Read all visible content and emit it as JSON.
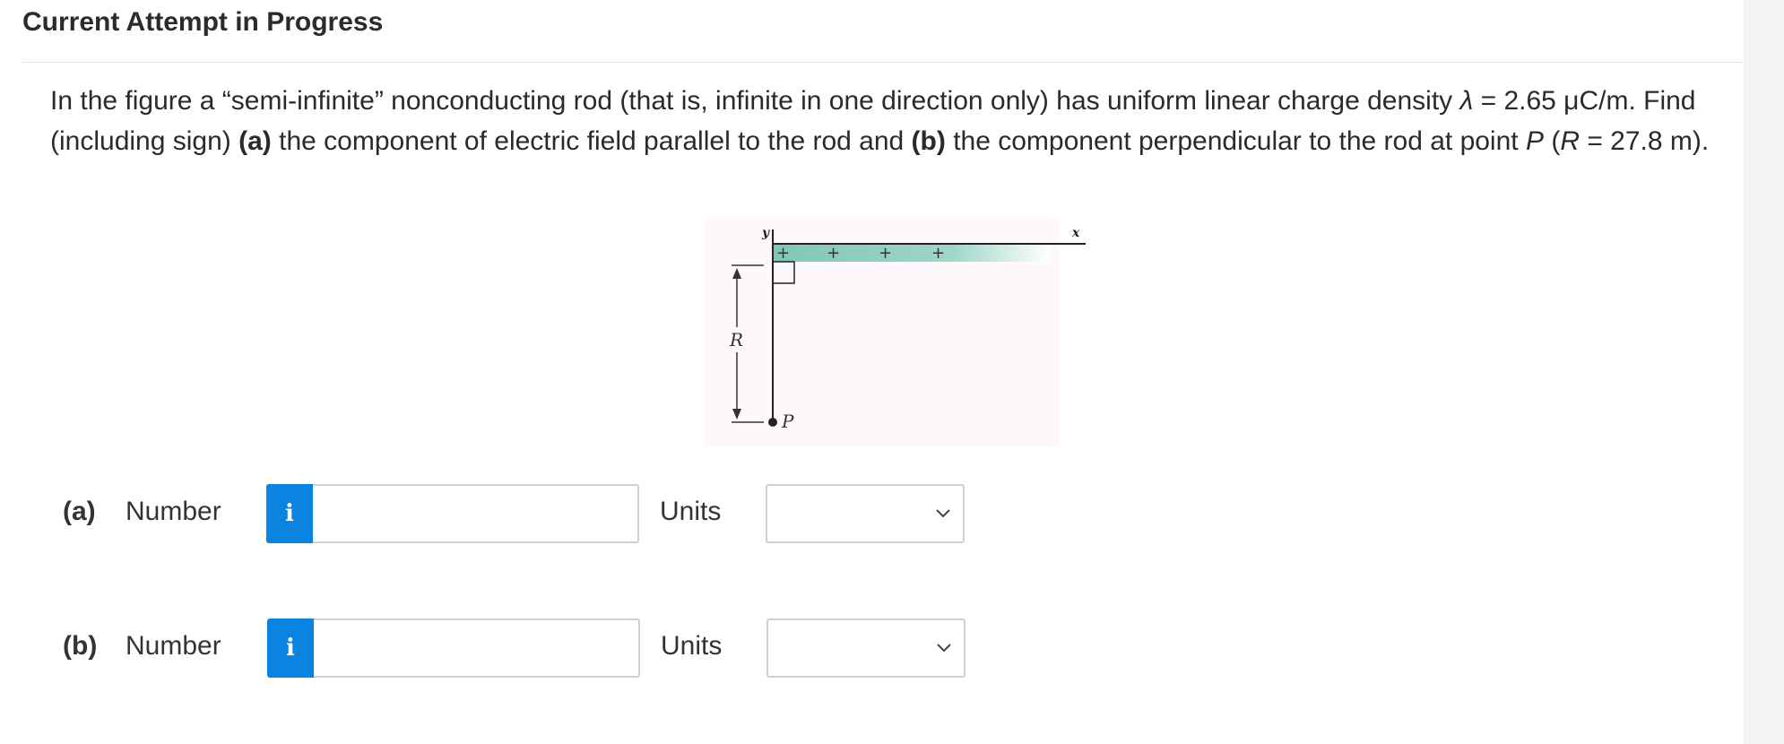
{
  "header": {
    "title": "Current Attempt in Progress"
  },
  "question": {
    "part1": "In the figure a “semi-infinite” nonconducting rod (that is, infinite in one direction only) has uniform linear charge density ",
    "lambda_symbol": "λ",
    "part2": " = 2.65 μC/m. Find (including sign) ",
    "a_label": "(a)",
    "part3": " the component of electric field parallel to the rod and ",
    "b_label": "(b)",
    "part4": " the component perpendicular to the rod at point ",
    "p_symbol": "P",
    "part5": " (",
    "r_symbol": "R",
    "part6": " = 27.8 m)."
  },
  "figure": {
    "y_label": "y",
    "x_label": "x",
    "r_label": "R",
    "p_label": "P",
    "charge_symbol": "+"
  },
  "answers": [
    {
      "part": "(a)",
      "number_label": "Number",
      "info": "i",
      "value": "",
      "units_label": "Units",
      "units_value": ""
    },
    {
      "part": "(b)",
      "number_label": "Number",
      "info": "i",
      "value": "",
      "units_label": "Units",
      "units_value": ""
    }
  ],
  "colors": {
    "rod_fill": "#7fc7b6",
    "info_button": "#0a84e0"
  }
}
